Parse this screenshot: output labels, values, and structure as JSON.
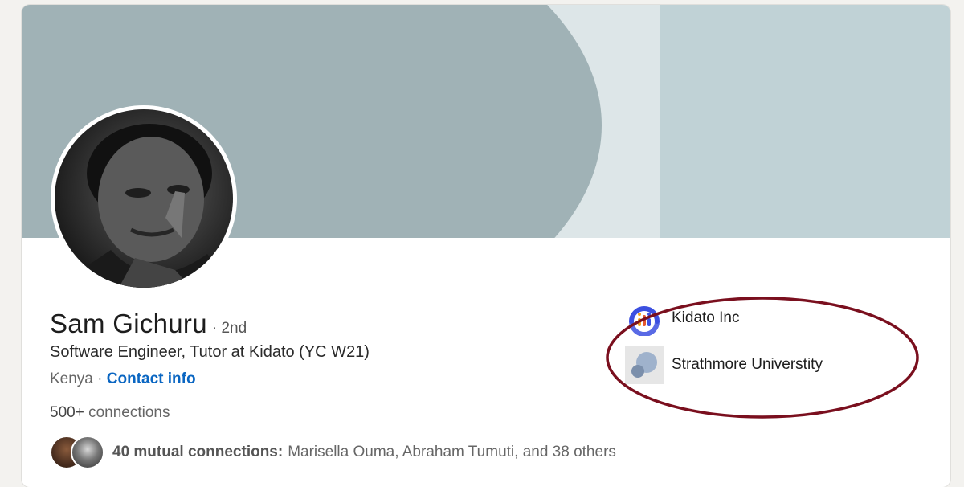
{
  "profile": {
    "name": "Sam Gichuru",
    "degree": "· 2nd",
    "headline": "Software Engineer, Tutor at Kidato (YC W21)",
    "location": "Kenya",
    "location_sep": " · ",
    "contact_label": "Contact info",
    "connections_count": "500+",
    "connections_label": " connections",
    "mutual_count": "40 mutual connections:",
    "mutual_names": "Marisella Ouma, Abraham Tumuti, and 38 others"
  },
  "orgs": [
    {
      "name": "Kidato Inc",
      "icon": "kidato-logo"
    },
    {
      "name": "Strathmore Universtity",
      "icon": "strathmore-logo"
    }
  ],
  "colors": {
    "link": "#0a66c2",
    "annotation": "#7a0f1e",
    "banner_dark": "#a0b2b6",
    "banner_light": "#dde6e8",
    "banner_right": "#c0d2d6"
  }
}
